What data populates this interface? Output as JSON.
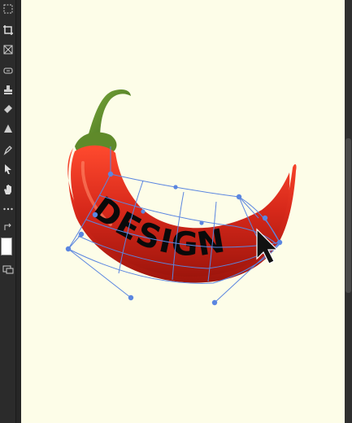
{
  "toolbar": {
    "tools": [
      "marquee-icon",
      "crop-icon",
      "frame-icon",
      "healing-icon",
      "stamp-icon",
      "eraser-icon",
      "gradient-icon",
      "pen-icon",
      "path-selection-icon",
      "hand-icon",
      "more-icon",
      "swap-colors-icon",
      "quick-mask-icon"
    ],
    "foreground_color": "#ffffff"
  },
  "canvas": {
    "background_color": "#fdfde8",
    "artwork_text": "DESIGN",
    "text_color": "#0a0a0a",
    "warp_mesh_color": "#5b86e0",
    "pepper_color": "#d6281a",
    "stem_color": "#5f8a2a"
  }
}
